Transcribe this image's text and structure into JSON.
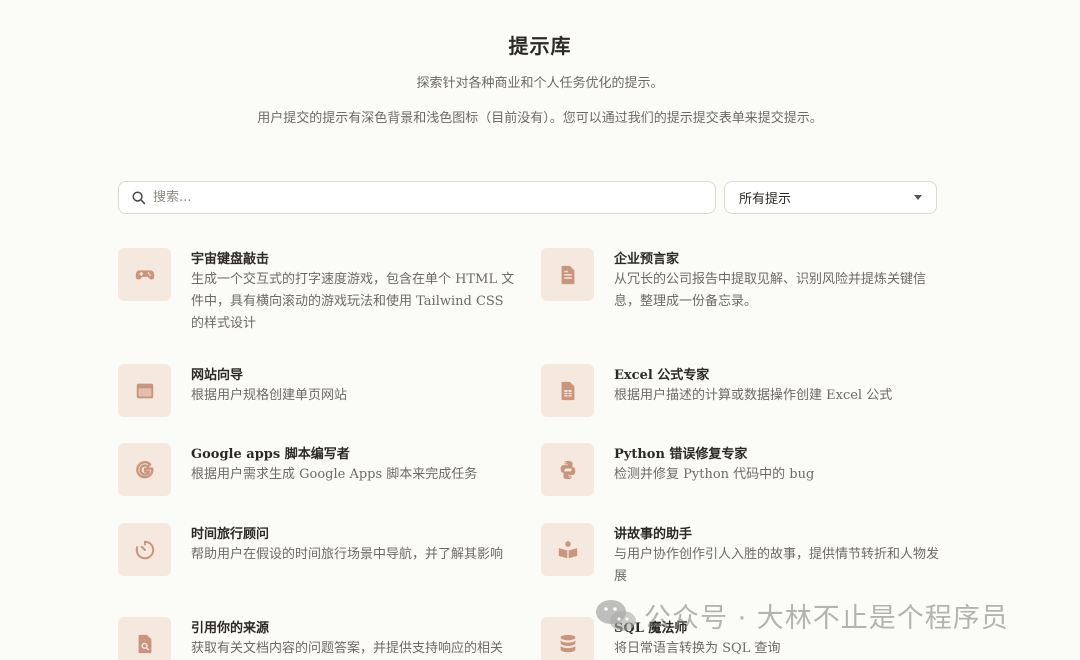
{
  "header": {
    "title": "提示库",
    "subtitle": "探索针对各种商业和个人任务优化的提示。",
    "note": "用户提交的提示有深色背景和浅色图标（目前没有）。您可以通过我们的提示提交表单来提交提示。"
  },
  "search": {
    "placeholder": "搜索...",
    "value": ""
  },
  "filter": {
    "selected": "所有提示"
  },
  "prompts": [
    {
      "title": "宇宙键盘敲击",
      "description": "生成一个交互式的打字速度游戏，包含在单个 HTML 文件中，具有横向滚动的游戏玩法和使用 Tailwind CSS 的样式设计",
      "icon": "gamepad-icon"
    },
    {
      "title": "企业预言家",
      "description": "从冗长的公司报告中提取见解、识别风险并提炼关键信息，整理成一份备忘录。",
      "icon": "document-icon"
    },
    {
      "title": "网站向导",
      "description": "根据用户规格创建单页网站",
      "icon": "browser-window-icon"
    },
    {
      "title": "Excel 公式专家",
      "description": "根据用户描述的计算或数据操作创建 Excel 公式",
      "icon": "spreadsheet-icon"
    },
    {
      "title": "Google apps 脚本编写者",
      "description": "根据用户需求生成 Google Apps 脚本来完成任务",
      "icon": "google-icon"
    },
    {
      "title": "Python 错误修复专家",
      "description": "检测并修复 Python 代码中的 bug",
      "icon": "python-icon"
    },
    {
      "title": "时间旅行顾问",
      "description": "帮助用户在假设的时间旅行场景中导航，并了解其影响",
      "icon": "timer-icon"
    },
    {
      "title": "讲故事的助手",
      "description": "与用户协作创作引人入胜的故事，提供情节转折和人物发展",
      "icon": "book-icon"
    },
    {
      "title": "引用你的来源",
      "description": "获取有关文档内容的问题答案，并提供支持响应的相关",
      "icon": "document-search-icon"
    },
    {
      "title": "SQL 魔法师",
      "description": "将日常语言转换为 SQL 查询",
      "icon": "database-icon"
    }
  ],
  "watermark": {
    "text": "公众号 · 大林不止是个程序员",
    "icon": "wechat-icon"
  },
  "colors": {
    "background": "#fbfbf7",
    "icon_tile": "#f5e8df",
    "icon_fg": "#c9967c"
  }
}
